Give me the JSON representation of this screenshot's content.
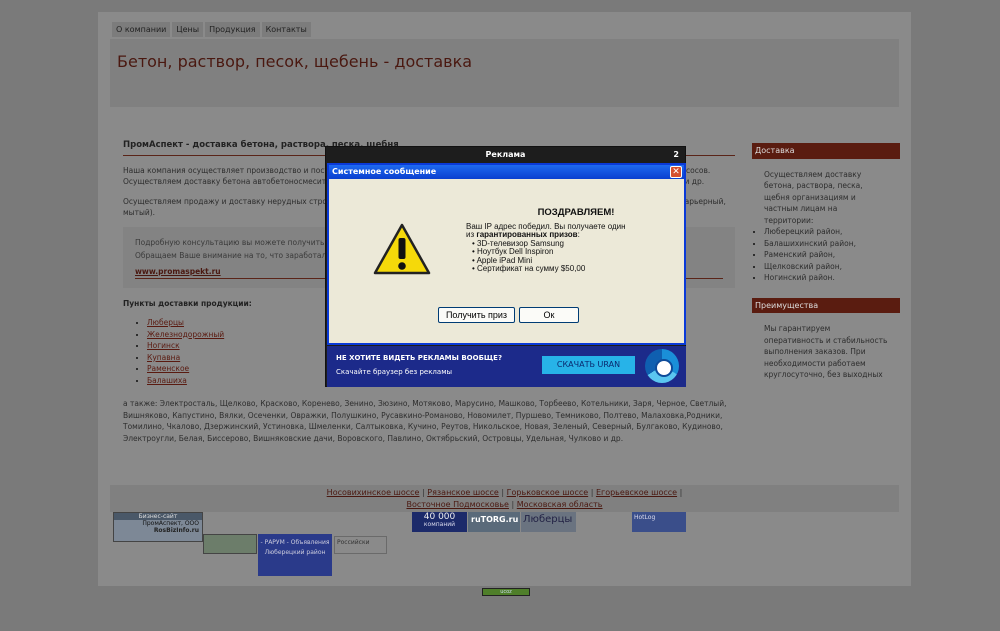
{
  "nav": [
    "О компании",
    "Цены",
    "Продукция",
    "Контакты"
  ],
  "header": {
    "title": "Бетон, раствор, песок, щебень - доставка"
  },
  "main": {
    "heading": "ПромАспект - доставка бетона, раствора, песка, щебня",
    "p1": "Наша компания осуществляет производство и поставку бетона, раствора, песка, щебня и других материалов, а также услуги автобетононасосов. Осуществляем доставку бетона автобетоносмесителями по Люберцам, Балашихе, Раменскому, Жуковскому, Ногинску, Некрасовка, Реутов и др.",
    "p2": "Осуществляем продажу и доставку нерудных строительных материалов (песок речной, песок карьерный, щебень гравийный, гранитный, карьерный, мытый).",
    "consult1": "Подробную консультацию вы можете получить по телефону",
    "consult2": "Обращаем Ваше внимание на то, что заработал новый сайт",
    "consult_link": "www.promaspekt.ru",
    "points_title": "Пункты доставки продукции:",
    "points": [
      "Люберцы",
      "Железнодорожный",
      "Ногинск",
      "Купавна",
      "Раменское",
      "Балашиха"
    ],
    "also": "а также: Электросталь, Щелково, Красково, Коренево, Зенино, Зюзино, Мотяково, Марусино, Машково, Торбеево, Котельники, Заря, Черное, Светлый, Вишняково, Капустино, Вялки, Осеченки, Овражки, Полушкино, Русавкино-Романово, Новомилет, Пуршево, Темниково, Полтево, Малаховка,Родники, Томилино, Чкалово, Дзержинский, Устиновка, Шмеленки, Салтыковка, Кучино, Реутов, Никольское, Новая, Зеленый, Северный, Булгаково, Кудиново, Электроугли, Белая, Биссерово, Вишняковские дачи, Воровского, Павлино, Октябрьский, Островцы, Удельная, Чулково и др."
  },
  "sidebar": {
    "delivery_title": "Доставка",
    "delivery_text": "Осуществляем доставку бетона, раствора, песка, щебня организациям и частным лицам на территории:",
    "delivery_items": [
      "Люберецкий район,",
      "Балашихинский район,",
      "Раменский район,",
      "Щелковский район,",
      "Ногинский район."
    ],
    "adv_title": "Преимущества",
    "adv_text": "Мы гарантируем оперативность и стабильность выполнения заказов. При необходимости работаем круглосуточно, без выходных"
  },
  "footer": {
    "links": [
      "Носовихинское шоссе",
      "Рязанское шоссе",
      "Горьковское шоссе",
      "Егорьевское шоссе",
      "Восточное Подмосковье",
      "Московская область"
    ],
    "sep": "|",
    "counters": {
      "biz1": "Бизнес-сайт",
      "biz2": "ПромАспект, ООО",
      "biz3": "RosBizInfo.ru",
      "c40": "40 000",
      "c40b": "компаний",
      "rutorg": "ruTORG.ru",
      "lub": "Люберцы",
      "rarum": "- РАРУМ - Объявления Люберецкий район",
      "ros": "Российски",
      "hotlog": "HotLog"
    }
  },
  "ad": {
    "title": "Реклама",
    "counter": "2",
    "window_title": "Системное сообщение",
    "congrats": "ПОЗДРАВЛЯЕМ!",
    "line1": "Ваш IP адрес победил. Вы получаете один",
    "line2_pre": "из ",
    "line2_bold": "гарантированных призов",
    "line2_post": ":",
    "prizes": [
      "• 3D-телевизор Samsung",
      "• Ноутбук Dell Inspiron",
      "• Apple iPad Mini",
      "• Сертификат на сумму $50,00"
    ],
    "btn_prize": "Получить приз",
    "btn_ok": "Ок",
    "promo_line1": "НЕ ХОТИТЕ ВИДЕТЬ РЕКЛАМЫ ВООБЩЕ?",
    "promo_line2": "Скачайте браузер без рекламы",
    "download": "СКАЧАТЬ URAN"
  },
  "ucoz": "ucoz"
}
